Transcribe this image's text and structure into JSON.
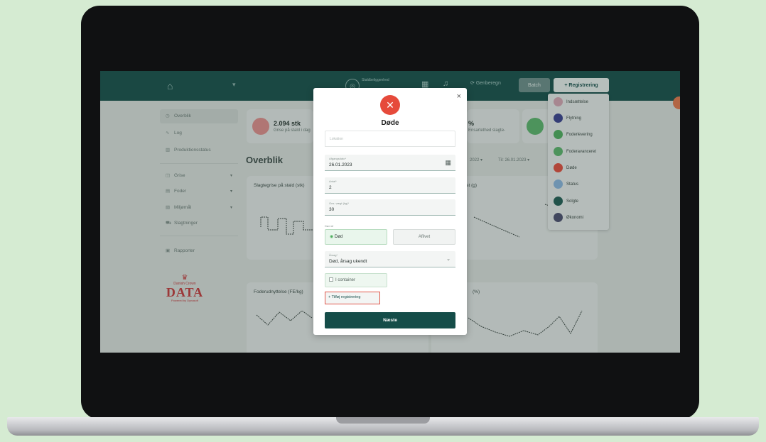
{
  "topbar": {
    "site_label": "Staldbeliggenhed",
    "recalc_label": "Genberegn",
    "batch_label": "Batch",
    "register_label": "+ Registrering"
  },
  "sidebar": {
    "items": [
      {
        "label": "Overblik",
        "icon": "gauge-icon"
      },
      {
        "label": "Log",
        "icon": "pulse-icon"
      },
      {
        "label": "Produktionsstatus",
        "icon": "bar-chart-icon"
      },
      {
        "label": "Grise",
        "icon": "pig-icon"
      },
      {
        "label": "Foder",
        "icon": "feed-icon"
      },
      {
        "label": "Miljømål",
        "icon": "meter-icon"
      },
      {
        "label": "Slagtninger",
        "icon": "truck-icon"
      },
      {
        "label": "Rapporter",
        "icon": "report-icon"
      }
    ],
    "brand": {
      "small": "Danish Crown",
      "name": "DATA",
      "powered": "Powered by Dynasoft"
    }
  },
  "dashboard": {
    "kpi1": {
      "value": "2.094 stk",
      "sub": "Grise på stald i dag"
    },
    "kpi2": {
      "value": "%",
      "sub": "Ensartethed slagte-"
    },
    "title": "Overblik",
    "date_from": "2022",
    "date_to": "Til: 26.01.2023",
    "chart1_title": "Slagtegrise på stald (stk)",
    "chart2_title": "kst (g)",
    "chart3_title": "Foderudnyttelse (FE/kg)",
    "chart4_title": "(%)"
  },
  "register_menu": {
    "items": [
      {
        "label": "Indsættelse",
        "color": "#d9a4b3"
      },
      {
        "label": "Flytning",
        "color": "#3a3d8f"
      },
      {
        "label": "Foderlevering",
        "color": "#4fae5e"
      },
      {
        "label": "Foderavanceret",
        "color": "#5cb56b"
      },
      {
        "label": "Døde",
        "color": "#e64a3b"
      },
      {
        "label": "Status",
        "color": "#8ab4e0"
      },
      {
        "label": "Solgte",
        "color": "#1f5a52"
      },
      {
        "label": "Økonomi",
        "color": "#4c4c6e"
      }
    ]
  },
  "modal": {
    "title": "Døde",
    "location_placeholder": "Lokation",
    "date_label": "Afgangsdato*",
    "date_value": "26.01.2023",
    "count_label": "Antal*",
    "count_value": "2",
    "weight_label": "Gns. vægt (kg)*",
    "weight_value": "30",
    "status_label": "Død af",
    "status_dead": "Død",
    "status_culled": "Aflivet",
    "cause_label": "Årsag*",
    "cause_value": "Død, årsag ukendt",
    "container_label": "I container",
    "add_label": "+ Tilføj registrering",
    "next_label": "Næste"
  }
}
